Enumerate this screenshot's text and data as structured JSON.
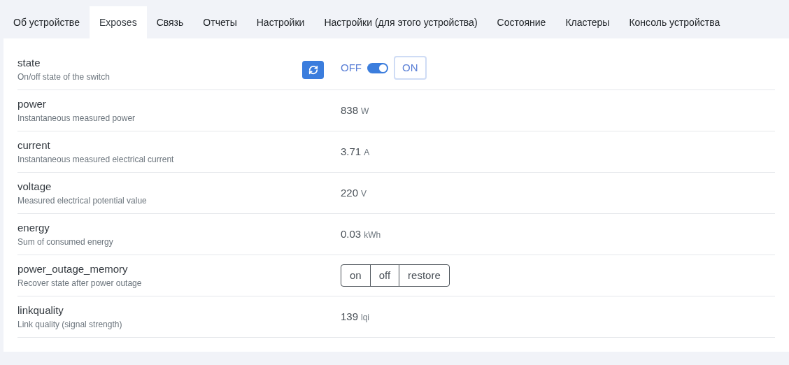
{
  "tabs": [
    {
      "label": "Об устройстве",
      "selected": false
    },
    {
      "label": "Exposes",
      "selected": true
    },
    {
      "label": "Связь",
      "selected": false
    },
    {
      "label": "Отчеты",
      "selected": false
    },
    {
      "label": "Настройки",
      "selected": false
    },
    {
      "label": "Настройки (для этого устройства)",
      "selected": false
    },
    {
      "label": "Состояние",
      "selected": false
    },
    {
      "label": "Кластеры",
      "selected": false
    },
    {
      "label": "Консоль устройства",
      "selected": false
    }
  ],
  "rows": [
    {
      "kind": "switch",
      "name": "state",
      "description": "On/off state of the switch",
      "off_label": "OFF",
      "on_label": "ON",
      "on": true
    },
    {
      "kind": "value",
      "name": "power",
      "description": "Instantaneous measured power",
      "value": "838",
      "unit": "W"
    },
    {
      "kind": "value",
      "name": "current",
      "description": "Instantaneous measured electrical current",
      "value": "3.71",
      "unit": "A"
    },
    {
      "kind": "value",
      "name": "voltage",
      "description": "Measured electrical potential value",
      "value": "220",
      "unit": "V"
    },
    {
      "kind": "value",
      "name": "energy",
      "description": "Sum of consumed energy",
      "value": "0.03",
      "unit": "kWh"
    },
    {
      "kind": "enum",
      "name": "power_outage_memory",
      "description": "Recover state after power outage",
      "options": [
        {
          "label": "on",
          "selected": false
        },
        {
          "label": "off",
          "selected": false
        },
        {
          "label": "restore",
          "selected": false
        }
      ]
    },
    {
      "kind": "value",
      "name": "linkquality",
      "description": "Link quality (signal strength)",
      "value": "139",
      "unit": "lqi"
    }
  ]
}
